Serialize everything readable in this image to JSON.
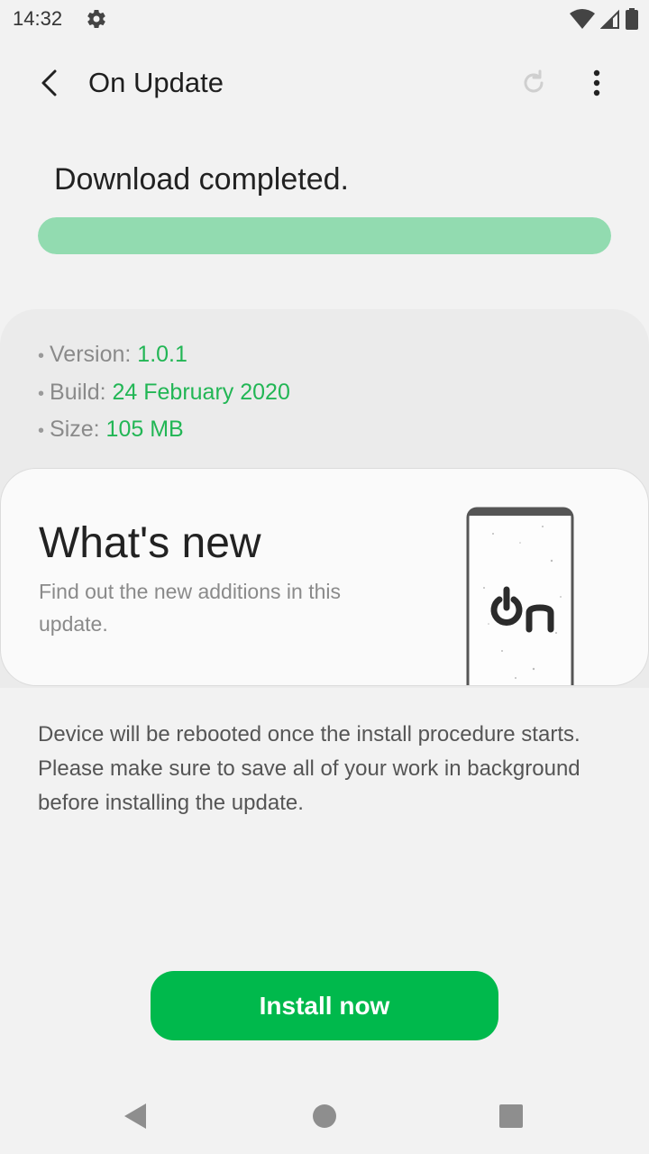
{
  "status_bar": {
    "time": "14:32",
    "left_icons": [
      "gear-icon"
    ],
    "right_icons": [
      "wifi-icon",
      "cell-signal-icon",
      "battery-icon"
    ]
  },
  "app_bar": {
    "title": "On Update",
    "icons": [
      "back-arrow-icon",
      "refresh-icon",
      "more-vert-icon"
    ]
  },
  "download": {
    "title": "Download completed.",
    "progress": 1.0,
    "progress_color": "#92dbb0"
  },
  "info": {
    "version_label": "Version: ",
    "version_value": "1.0.1",
    "build_label": "Build: ",
    "build_value": "24 February 2020",
    "size_label": "Size: ",
    "size_value": "105 MB",
    "value_color": "#22b655"
  },
  "whats_new": {
    "title": "What's new",
    "subtitle": "Find out the new additions in this update.",
    "logo_text": "On"
  },
  "notice": "Device will be rebooted once the install procedure starts. Please make sure to save all of your work in background before installing the update.",
  "install_button": {
    "label": "Install now",
    "color": "#00b94c"
  },
  "nav_bar": {
    "icons": [
      "nav-back-icon",
      "nav-home-icon",
      "nav-recents-icon"
    ]
  }
}
